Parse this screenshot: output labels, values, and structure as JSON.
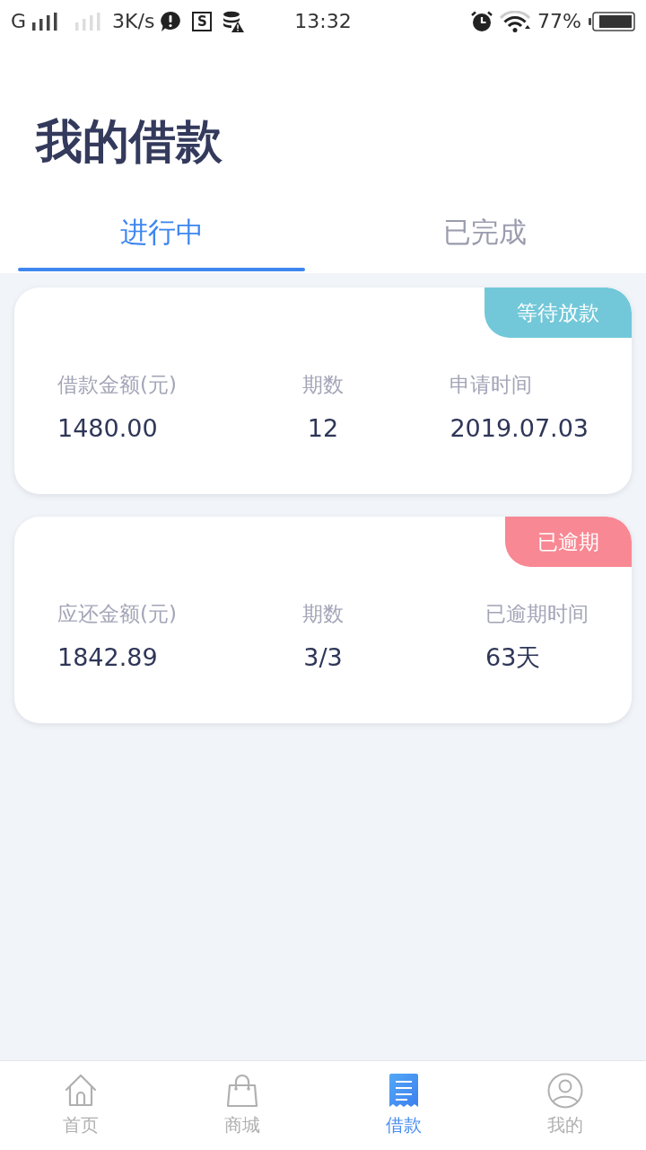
{
  "status_bar": {
    "network_type": "G",
    "speed": "3K/s",
    "app_letter": "S",
    "time": "13:32",
    "battery": "77%"
  },
  "title": "我的借款",
  "tabs": [
    {
      "label": "进行中",
      "selected": true
    },
    {
      "label": "已完成",
      "selected": false
    }
  ],
  "loans": [
    {
      "status": "等待放款",
      "color": "#72c8d9",
      "fields": [
        {
          "label": "借款金额(元)",
          "value": "1480.00"
        },
        {
          "label": "期数",
          "value": "12"
        },
        {
          "label": "申请时间",
          "value": "2019.07.03"
        }
      ]
    },
    {
      "status": "已逾期",
      "color": "#f88893",
      "fields": [
        {
          "label": "应还金额(元)",
          "value": "1842.89"
        },
        {
          "label": "期数",
          "value": "3/3"
        },
        {
          "label": "已逾期时间",
          "value": "63天"
        }
      ]
    }
  ],
  "nav": [
    {
      "label": "首页",
      "selected": false
    },
    {
      "label": "商城",
      "selected": false
    },
    {
      "label": "借款",
      "selected": true
    },
    {
      "label": "我的",
      "selected": false
    }
  ]
}
